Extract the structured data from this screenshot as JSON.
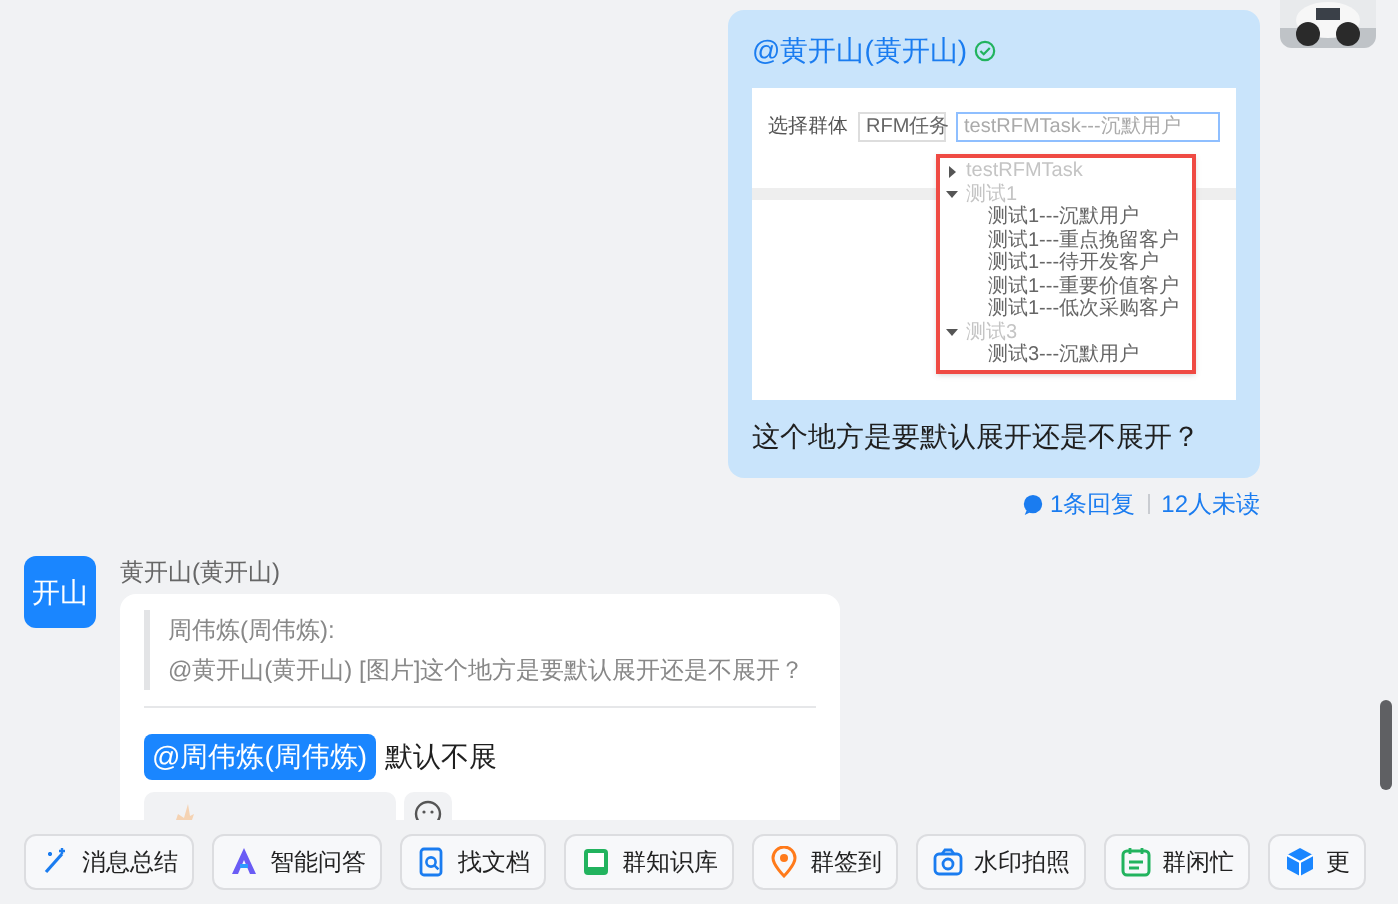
{
  "messages": [
    {
      "kind": "image_text",
      "mention": "@黄开山(黄开山)",
      "screenshot": {
        "filter_label": "选择群体",
        "task_select": "RFM任务",
        "search_value": "testRFMTask---沉默用户",
        "tree": [
          {
            "label": "testRFMTask",
            "expanded": false
          },
          {
            "label": "测试1",
            "expanded": true,
            "children": [
              {
                "label": "测试1---沉默用户"
              },
              {
                "label": "测试1---重点挽留客户"
              },
              {
                "label": "测试1---待开发客户"
              },
              {
                "label": "测试1---重要价值客户"
              },
              {
                "label": "测试1---低次采购客户"
              }
            ]
          },
          {
            "label": "测试3",
            "expanded": true,
            "children": [
              {
                "label": "测试3---沉默用户"
              }
            ]
          }
        ]
      },
      "text": "这个地方是要默认展开还是不展开？",
      "replies": "1条回复",
      "unread": "12人未读"
    },
    {
      "kind": "reply",
      "avatar": "开山",
      "sender": "黄开山(黄开山)",
      "quote_author": "周伟炼(周伟炼):",
      "quote_text": "@黄开山(黄开山) [图片]这个地方是要默认展开还是不展开？",
      "mention": "@周伟炼(周伟炼)",
      "text": "默认不展"
    }
  ],
  "toolbar": [
    {
      "label": "消息总结"
    },
    {
      "label": "智能问答"
    },
    {
      "label": "找文档"
    },
    {
      "label": "群知识库"
    },
    {
      "label": "群签到"
    },
    {
      "label": "水印拍照"
    },
    {
      "label": "群闲忙"
    },
    {
      "label": "更"
    }
  ]
}
